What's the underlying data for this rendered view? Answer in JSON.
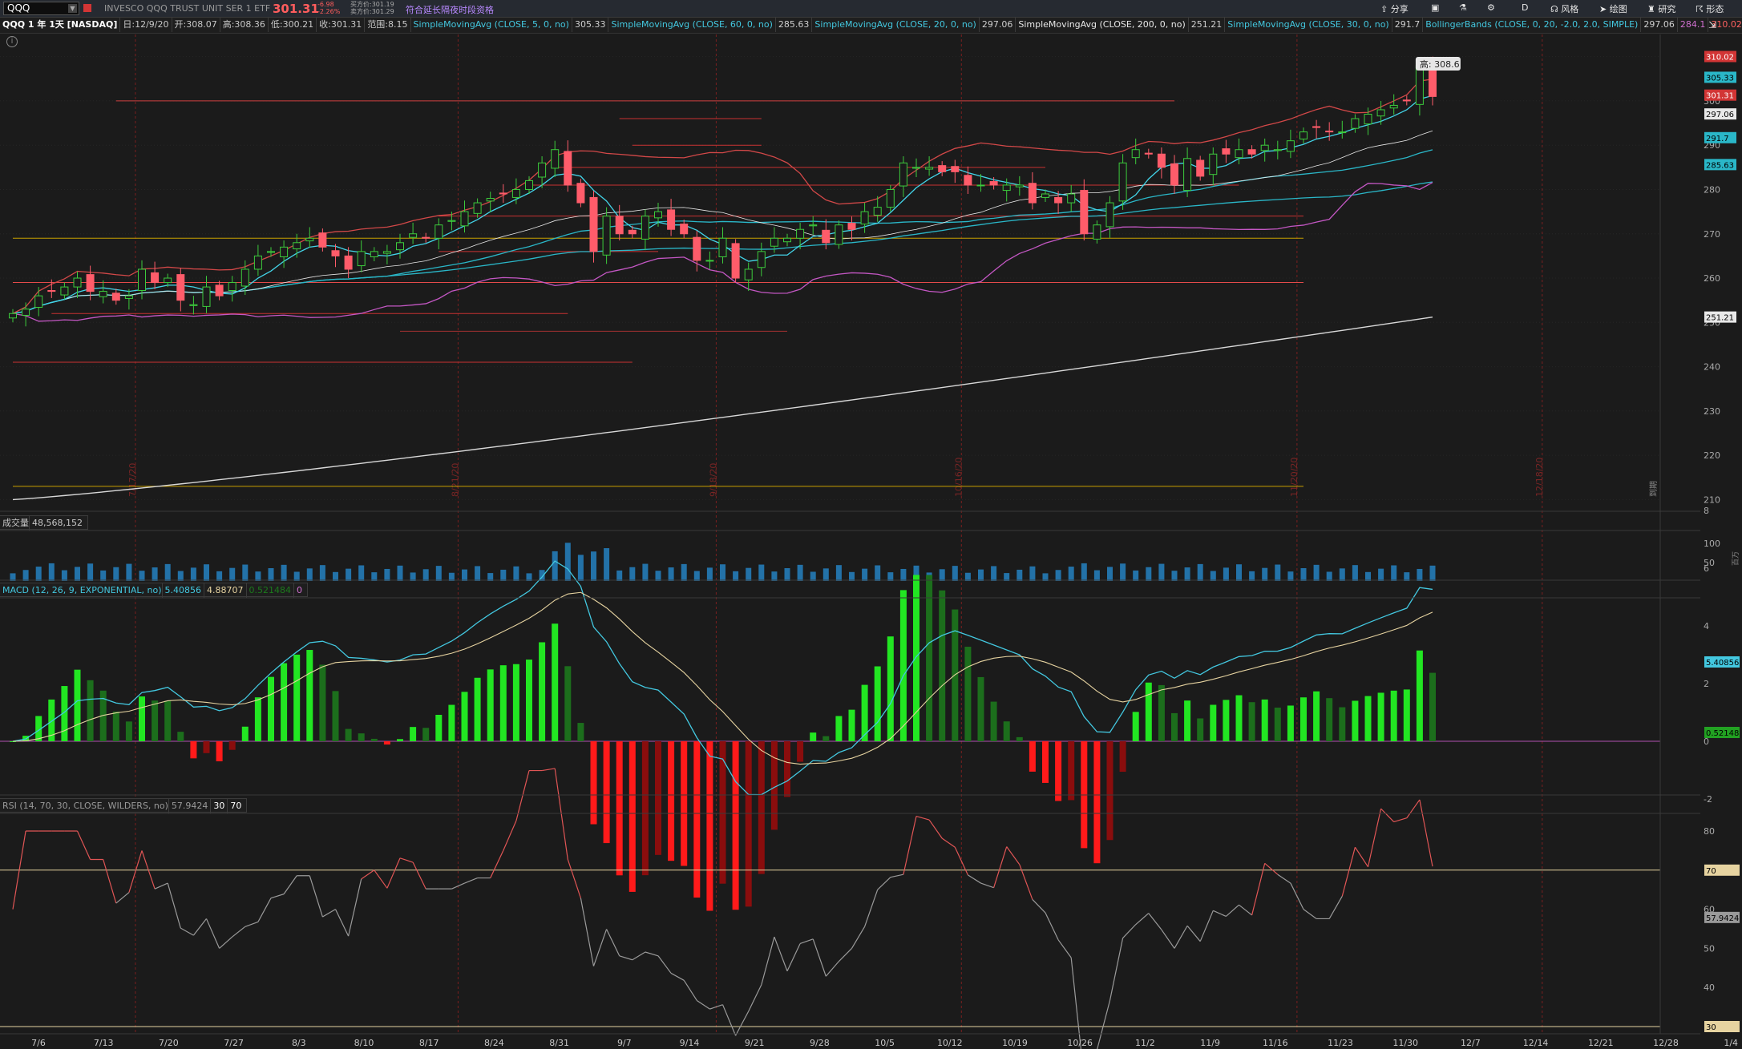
{
  "topbar": {
    "symbol": "QQQ",
    "description": "INVESCO QQQ TRUST UNIT SER 1 ETF",
    "last": "301.31",
    "change": "-6.98",
    "change_pct": "-2.26%",
    "bid": "买方价:301.19",
    "ask": "卖方价:301.29",
    "notice": "符合延长隔夜时段资格",
    "tools": {
      "share": "分享",
      "flask_icon": "flask-icon",
      "aggregation": "D",
      "style": "风格",
      "drawing": "绘图",
      "research": "研究",
      "pattern": "形态"
    }
  },
  "studies_bar": {
    "title": "QQQ 1 年 1天 [NASDAQ]",
    "date": "日:12/9/20",
    "open": "开:308.07",
    "high": "高:308.36",
    "low": "低:300.21",
    "close": "收:301.31",
    "range": "范围:8.15",
    "sma5": "SimpleMovingAvg (CLOSE, 5, 0, no)",
    "sma5_val": "305.33",
    "sma60": "SimpleMovingAvg (CLOSE, 60, 0, no)",
    "sma60_val": "285.63",
    "sma20": "SimpleMovingAvg (CLOSE, 20, 0, no)",
    "sma20_val": "297.06",
    "sma200": "SimpleMovingAvg (CLOSE, 200, 0, no)",
    "sma200_val": "251.21",
    "sma30": "SimpleMovingAvg (CLOSE, 30, 0, no)",
    "sma30_val": "291.7",
    "bb": "BollingerBands (CLOSE, 0, 20, -2.0, 2.0, SIMPLE)",
    "bb_mid": "297.06",
    "bb_low": "284.1",
    "bb_up": "310.02"
  },
  "price_pane": {
    "high_callout": "高: 308.6",
    "axis_ticks": [
      "310",
      "300",
      "290",
      "280",
      "270",
      "260",
      "250",
      "240",
      "230",
      "220",
      "210"
    ],
    "bubbles": {
      "bb_up": "310.02",
      "sma5": "305.33",
      "last": "301.31",
      "sma20": "297.06",
      "sma30": "291.7",
      "sma60": "285.63",
      "sma200": "251.21"
    },
    "vlines": [
      "7/17/20",
      "8/21/20",
      "9/18/20",
      "10/16/20",
      "11/20/20",
      "12/18/20"
    ],
    "expiry_note": "到期"
  },
  "volume_pane": {
    "label": "成交量",
    "value": "48,568,152",
    "axis_ticks": [
      "100",
      "50"
    ],
    "axis_unit": "百万"
  },
  "macd_pane": {
    "label": "MACD (12, 26, 9, EXPONENTIAL, no)",
    "value": "5.40856",
    "avg": "4.88707",
    "diff": "0.521484",
    "zero": "0",
    "axis_ticks": [
      "8",
      "6",
      "4",
      "2",
      "0",
      "-2"
    ],
    "bubbles": {
      "value": "5.40856",
      "diff": "0.52148"
    }
  },
  "rsi_pane": {
    "label": "RSI (14, 70, 30, CLOSE, WILDERS, no)",
    "value": "57.9424",
    "ob": "70",
    "os": "30",
    "axis_ticks": [
      "80",
      "60",
      "50",
      "40"
    ],
    "bubbles": {
      "ob": "70",
      "value": "57.9424",
      "os": "30"
    }
  },
  "x_axis": [
    "7/6",
    "7/13",
    "7/20",
    "7/27",
    "8/3",
    "8/10",
    "8/17",
    "8/24",
    "8/31",
    "9/7",
    "9/14",
    "9/21",
    "9/28",
    "10/5",
    "10/12",
    "10/19",
    "10/26",
    "11/2",
    "11/9",
    "11/16",
    "11/23",
    "11/30",
    "12/7",
    "12/14",
    "12/21",
    "12/28",
    "1/4"
  ],
  "chart_data": {
    "type": "candlestick",
    "dates": [
      "7/6",
      "7/7",
      "7/8",
      "7/9",
      "7/10",
      "7/13",
      "7/14",
      "7/15",
      "7/16",
      "7/17",
      "7/20",
      "7/21",
      "7/22",
      "7/23",
      "7/24",
      "7/27",
      "7/28",
      "7/29",
      "7/30",
      "7/31",
      "8/3",
      "8/4",
      "8/5",
      "8/6",
      "8/7",
      "8/10",
      "8/11",
      "8/12",
      "8/13",
      "8/14",
      "8/17",
      "8/18",
      "8/19",
      "8/20",
      "8/21",
      "8/24",
      "8/25",
      "8/26",
      "8/27",
      "8/28",
      "8/31",
      "9/1",
      "9/2",
      "9/3",
      "9/4",
      "9/8",
      "9/9",
      "9/10",
      "9/11",
      "9/14",
      "9/15",
      "9/16",
      "9/17",
      "9/18",
      "9/21",
      "9/22",
      "9/23",
      "9/24",
      "9/25",
      "9/28",
      "9/29",
      "9/30",
      "10/1",
      "10/2",
      "10/5",
      "10/6",
      "10/7",
      "10/8",
      "10/9",
      "10/12",
      "10/13",
      "10/14",
      "10/15",
      "10/16",
      "10/19",
      "10/20",
      "10/21",
      "10/22",
      "10/23",
      "10/26",
      "10/27",
      "10/28",
      "10/29",
      "10/30",
      "11/2",
      "11/3",
      "11/4",
      "11/5",
      "11/6",
      "11/9",
      "11/10",
      "11/11",
      "11/12",
      "11/13",
      "11/16",
      "11/17",
      "11/18",
      "11/19",
      "11/20",
      "11/23",
      "11/24",
      "11/25",
      "11/27",
      "11/30",
      "12/1",
      "12/2",
      "12/3",
      "12/4",
      "12/7",
      "12/8",
      "12/9"
    ],
    "close": [
      252,
      253,
      256,
      257,
      258,
      260,
      257,
      257,
      255,
      256,
      262,
      259,
      260,
      255,
      254,
      258,
      256,
      259,
      262,
      265,
      266,
      267,
      268,
      269,
      267,
      265,
      262,
      266,
      266,
      266,
      268,
      270,
      269,
      272,
      273,
      275,
      277,
      278,
      279,
      280,
      282,
      286,
      289,
      281,
      277,
      266,
      274,
      270,
      270,
      274,
      275,
      271,
      270,
      264,
      264,
      269,
      260,
      262,
      266,
      269,
      269,
      271,
      272,
      268,
      272,
      271,
      275,
      276,
      280,
      286,
      285,
      285,
      284,
      284,
      281,
      281,
      281,
      281,
      281,
      277,
      279,
      277,
      279,
      270,
      272,
      277,
      286,
      289,
      288,
      285,
      281,
      287,
      283,
      288,
      288,
      289,
      288,
      290,
      289,
      291,
      293,
      294,
      293,
      293,
      296,
      297,
      298,
      299,
      300,
      308,
      301
    ],
    "sma5_last": 305.33,
    "sma20_last": 297.06,
    "sma30_last": 291.7,
    "sma60_last": 285.63,
    "sma200_last": 251.21,
    "bb": {
      "upper_last": 310.02,
      "lower_last": 284.1
    },
    "volume_last": 48568152,
    "macd_last": 5.40856,
    "macd_avg_last": 4.88707,
    "macd_diff_last": 0.521484,
    "rsi_last": 57.9424,
    "rsi_ob": 70,
    "rsi_os": 30,
    "price_range": [
      207,
      315
    ]
  }
}
